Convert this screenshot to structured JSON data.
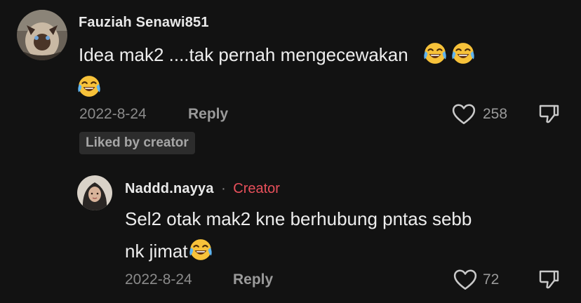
{
  "comments": [
    {
      "username": "Fauziah Senawi851",
      "text_line1": "Idea mak2 ....tak pernah mengecewakan",
      "date": "2022-8-24",
      "reply_label": "Reply",
      "likes": "258",
      "badge": "Liked by creator"
    },
    {
      "username": "Naddd.nayya",
      "separator": "·",
      "creator_label": "Creator",
      "text_line1": "Sel2 otak mak2 kne berhubung pntas sebb",
      "text_line2": "nk jimat",
      "date": "2022-8-24",
      "reply_label": "Reply",
      "likes": "72"
    }
  ],
  "icons": {
    "like": "heart-outline-icon",
    "dislike": "thumbs-down-icon",
    "emoji": "laughing-tears-emoji"
  },
  "colors": {
    "background": "#121212",
    "creator_accent": "#e8505b",
    "muted": "#8a8a8a",
    "emoji_face": "#f7c23a"
  }
}
